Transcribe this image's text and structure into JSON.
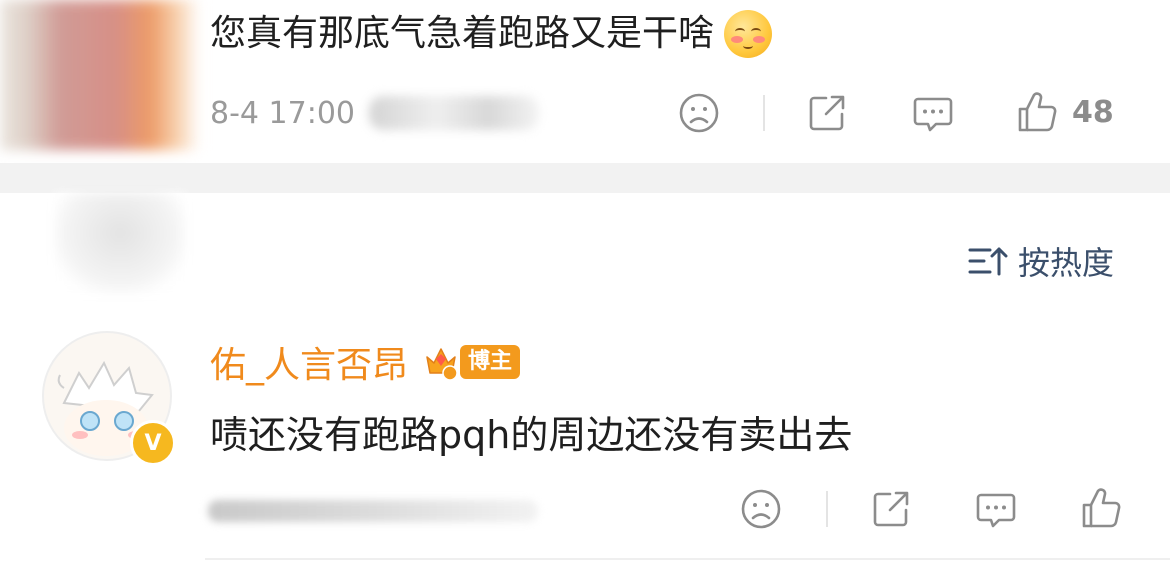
{
  "comment": {
    "text": "您真有那底气急着跑路又是干啥",
    "emoji": "blush-emoji",
    "timestamp": "8-4 17:00",
    "like_count": "48"
  },
  "sort": {
    "label": "按热度",
    "icon": "sort-icon"
  },
  "reply": {
    "username": "佑_人言否昂",
    "badge": "博主",
    "verified_mark": "V",
    "text": "啧还没有跑路pqh的周边还没有卖出去"
  },
  "icons": {
    "dislike": "frown-icon",
    "share": "share-icon",
    "comment": "comment-icon",
    "like": "thumbs-up-icon"
  },
  "colors": {
    "username": "#f08a1c",
    "badge": "#f39a1d",
    "verified": "#f6b81f",
    "sort_label": "#3b4f6b",
    "icon": "#8c8c8c"
  }
}
